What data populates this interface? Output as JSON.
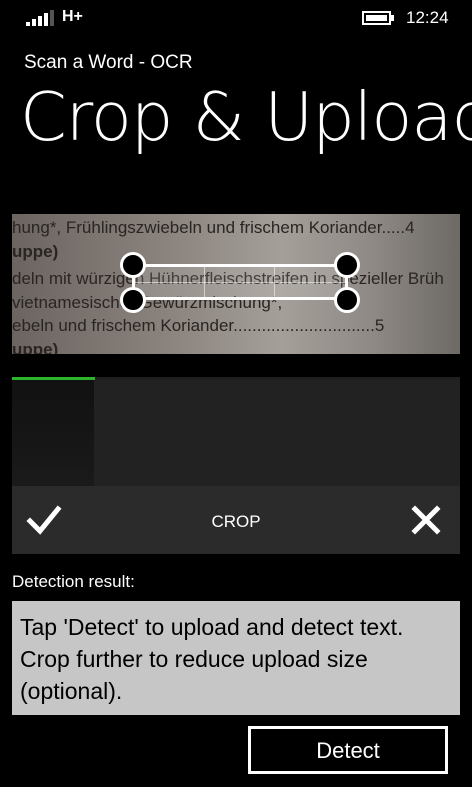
{
  "status": {
    "network": "H+",
    "time": "12:24"
  },
  "app": {
    "title": "Scan a Word - OCR"
  },
  "page": {
    "title": "Crop & Upload"
  },
  "image": {
    "lines": [
      "hung*, Frühlingszwiebeln und frischem Koriander.....4",
      "uppe)",
      "deln mit würzigen Hühnerfleischstreifen in spezieller Brüh",
      "vietnamesischer Gewürzmischung*,",
      "ebeln und frischem Koriander..............................5",
      "uppe)"
    ]
  },
  "progress": {
    "fraction": 0.185
  },
  "colors": {
    "accent": "#2ab52a",
    "result_bg": "#c6c6c6",
    "app_bar": "#2b2b2b"
  },
  "toolbar": {
    "crop_label": "CROP",
    "confirm_icon": "checkmark-icon",
    "cancel_icon": "close-icon"
  },
  "result": {
    "label": "Detection result:",
    "text": "Tap 'Detect' to upload and detect text. Crop further to reduce upload size (optional)."
  },
  "detect": {
    "label": "Detect"
  }
}
